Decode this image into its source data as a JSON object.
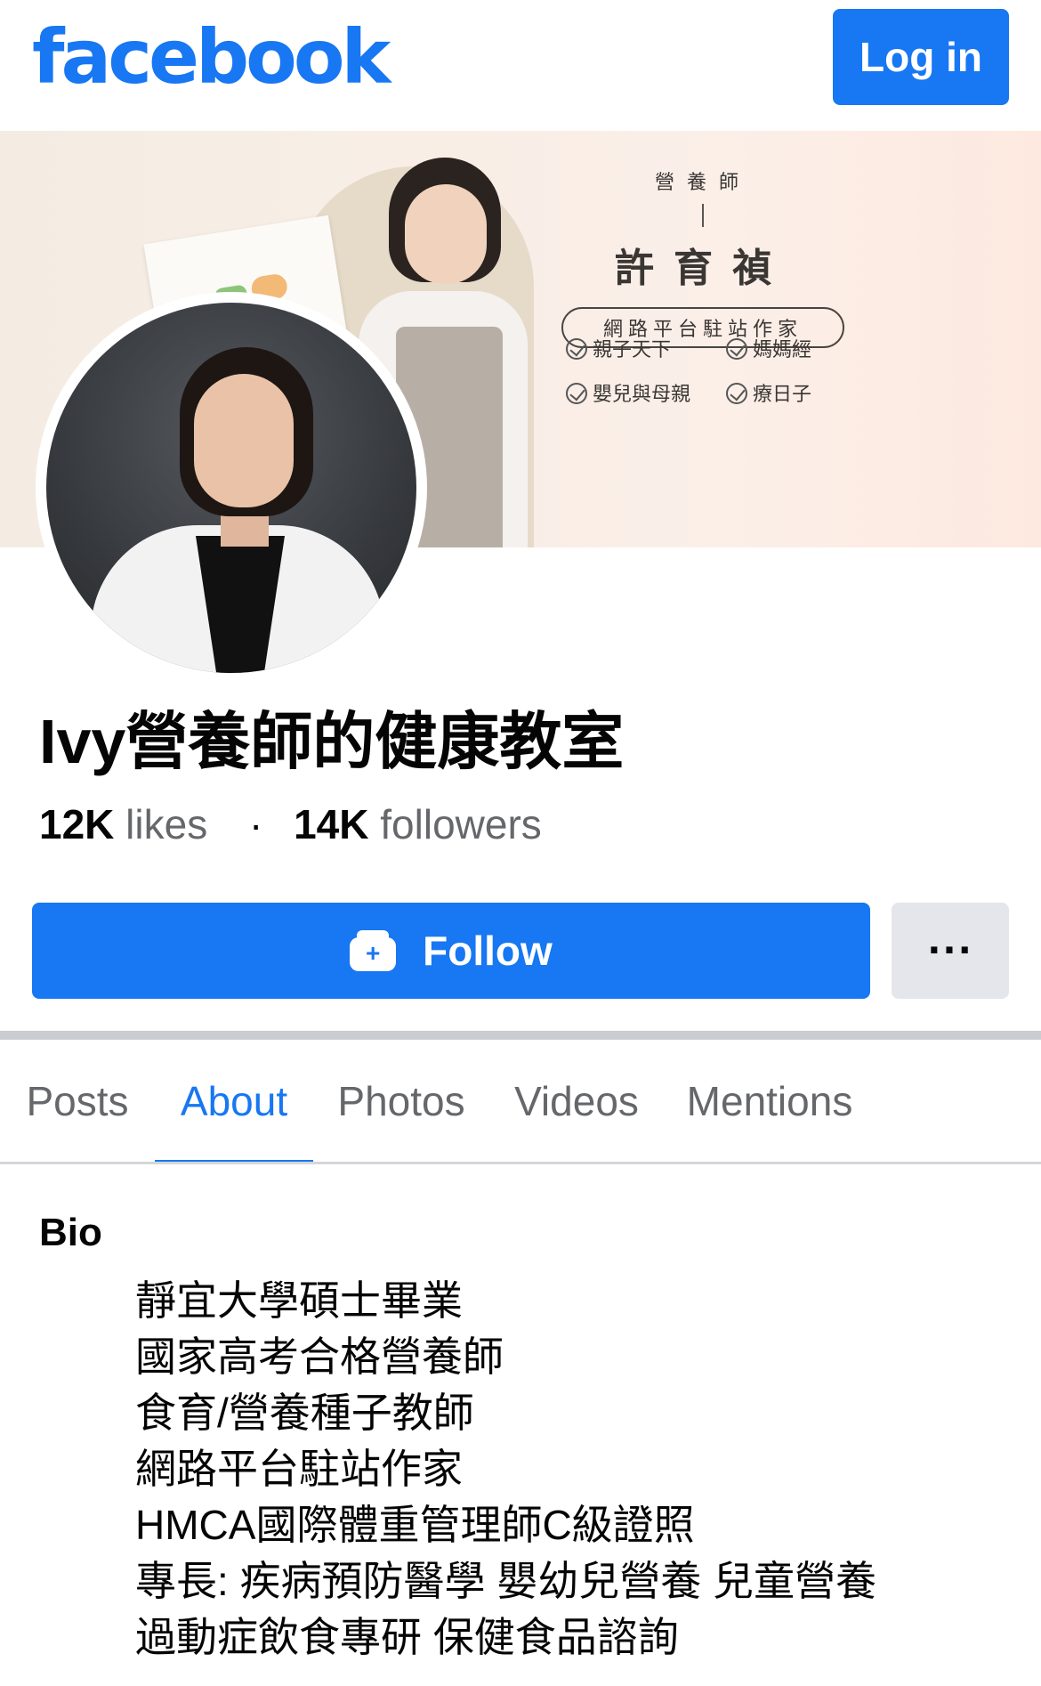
{
  "header": {
    "logo_text": "facebook",
    "login_label": "Log in"
  },
  "cover": {
    "role": "營養師",
    "name": "許育禎",
    "pill": "網路平台駐站作家",
    "checks": [
      "親子天下",
      "媽媽經",
      "嬰兒與母親",
      "療日子"
    ]
  },
  "page": {
    "name": "Ivy營養師的健康教室",
    "likes_count": "12K",
    "likes_label": "likes",
    "separator": "·",
    "followers_count": "14K",
    "followers_label": "followers"
  },
  "actions": {
    "follow_label": "Follow",
    "more_label": "···"
  },
  "tabs": [
    {
      "label": "Posts",
      "active": false
    },
    {
      "label": "About",
      "active": true
    },
    {
      "label": "Photos",
      "active": false
    },
    {
      "label": "Videos",
      "active": false
    },
    {
      "label": "Mentions",
      "active": false
    }
  ],
  "bio": {
    "title": "Bio",
    "lines": [
      "靜宜大學碩士畢業",
      "國家高考合格營養師",
      "食育/營養種子教師",
      "網路平台駐站作家",
      "HMCA國際體重管理師C級證照",
      "專長: 疾病預防醫學 嬰幼兒營養 兒童營養",
      "過動症飲食專研 保健食品諮詢"
    ]
  },
  "colors": {
    "brand": "#1877f2",
    "secondary_button": "#e4e6eb",
    "muted_text": "#65676b"
  }
}
